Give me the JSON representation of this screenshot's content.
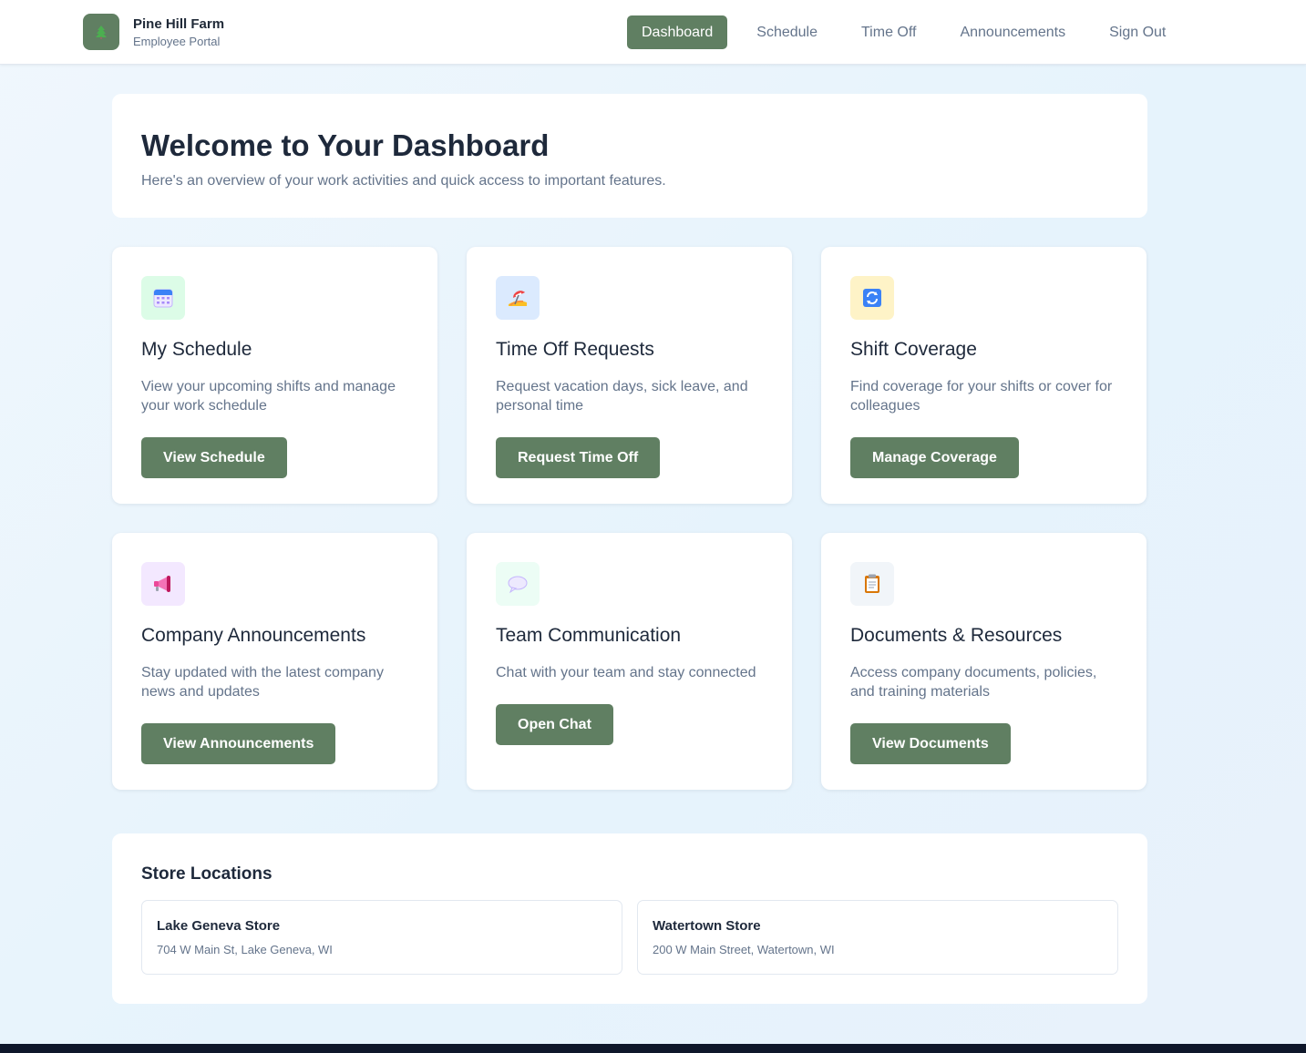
{
  "brand": {
    "name": "Pine Hill Farm",
    "subtitle": "Employee Portal",
    "accent": "#607f62"
  },
  "nav": {
    "items": [
      {
        "label": "Dashboard",
        "active": true
      },
      {
        "label": "Schedule",
        "active": false
      },
      {
        "label": "Time Off",
        "active": false
      },
      {
        "label": "Announcements",
        "active": false
      },
      {
        "label": "Sign Out",
        "active": false
      }
    ]
  },
  "welcome": {
    "title": "Welcome to Your Dashboard",
    "subtitle": "Here's an overview of your work activities and quick access to important features."
  },
  "cards": [
    {
      "icon": "calendar-icon",
      "icon_bg": "#dcfce7",
      "title": "My Schedule",
      "description": "View your upcoming shifts and manage your work schedule",
      "button": "View Schedule"
    },
    {
      "icon": "beach-umbrella-icon",
      "icon_bg": "#dbeafe",
      "title": "Time Off Requests",
      "description": "Request vacation days, sick leave, and personal time",
      "button": "Request Time Off"
    },
    {
      "icon": "refresh-icon",
      "icon_bg": "#fef3c7",
      "title": "Shift Coverage",
      "description": "Find coverage for your shifts or cover for colleagues",
      "button": "Manage Coverage"
    },
    {
      "icon": "megaphone-icon",
      "icon_bg": "#f3e8ff",
      "title": "Company Announcements",
      "description": "Stay updated with the latest company news and updates",
      "button": "View Announcements"
    },
    {
      "icon": "chat-bubble-icon",
      "icon_bg": "#ecfdf5",
      "title": "Team Communication",
      "description": "Chat with your team and stay connected",
      "button": "Open Chat"
    },
    {
      "icon": "clipboard-icon",
      "icon_bg": "#f1f5f9",
      "title": "Documents & Resources",
      "description": "Access company documents, policies, and training materials",
      "button": "View Documents"
    }
  ],
  "stores": {
    "title": "Store Locations",
    "items": [
      {
        "name": "Lake Geneva Store",
        "address": "704 W Main St, Lake Geneva, WI"
      },
      {
        "name": "Watertown Store",
        "address": "200 W Main Street, Watertown, WI"
      }
    ]
  }
}
